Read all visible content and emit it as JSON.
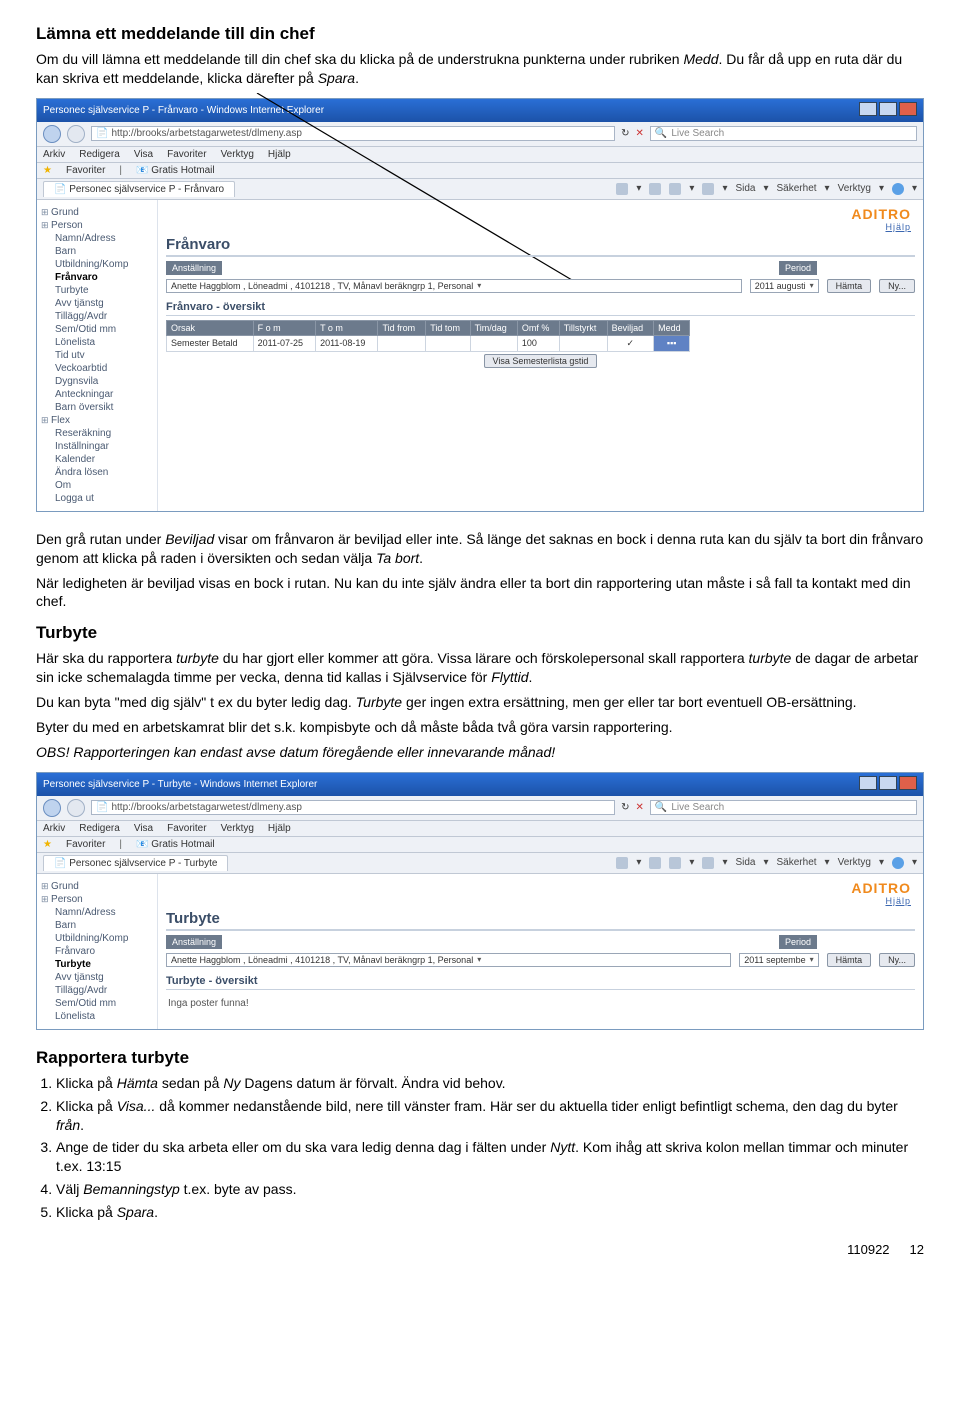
{
  "section1": {
    "heading": "Lämna ett meddelande till din chef",
    "para1_a": "Om du vill lämna ett meddelande till din chef ska du klicka på de understrukna punkterna under rubriken ",
    "para1_b": "Medd",
    "para1_c": ". Du får då upp en ruta där du kan skriva ett meddelande, klicka därefter på ",
    "para1_d": "Spara",
    "para1_e": "."
  },
  "shot1": {
    "title": "Personec självservice P - Frånvaro - Windows Internet Explorer",
    "url": "http://brooks/arbetstagarwetest/dlmeny.asp",
    "search_placeholder": "Live Search",
    "menus": [
      "Arkiv",
      "Redigera",
      "Visa",
      "Favoriter",
      "Verktyg",
      "Hjälp"
    ],
    "fav_label": "Favoriter",
    "fav_item": "Gratis Hotmail",
    "tab": "Personec självservice P - Frånvaro",
    "tools": [
      "Sida",
      "Säkerhet",
      "Verktyg"
    ],
    "brand": "ADITRO",
    "help": "Hjälp",
    "sidebar": {
      "root": "Grund",
      "person": "Person",
      "items": [
        "Namn/Adress",
        "Barn",
        "Utbildning/Komp",
        "Frånvaro",
        "Turbyte",
        "Avv tjänstg",
        "Tillägg/Avdr",
        "Sem/Otid mm",
        "Lönelista",
        "Tid utv",
        "Veckoarbtid",
        "Dygnsvila",
        "Anteckningar",
        "Barn översikt"
      ],
      "flex": "Flex",
      "flex_items": [
        "Reseräkning",
        "Inställningar",
        "Kalender",
        "Ändra lösen",
        "Om",
        "Logga ut"
      ],
      "selected": "Frånvaro"
    },
    "panel_h1": "Frånvaro",
    "label_anst": "Anställning",
    "label_period": "Period",
    "anst_value": "Anette Haggblom , Löneadmi , 4101218 , TV, Månavl beräkngrp 1, Personal",
    "period_value": "2011 augusti",
    "btn_hamta": "Hämta",
    "btn_ny": "Ny...",
    "panel_h2": "Frånvaro - översikt",
    "cols": [
      "Orsak",
      "F o m",
      "T o m",
      "Tid from",
      "Tid tom",
      "Tim/dag",
      "Omf %",
      "Tillstyrkt",
      "Beviljad",
      "Medd"
    ],
    "row": {
      "orsak": "Semester Betald",
      "fom": "2011-07-25",
      "tom": "2011-08-19",
      "omf": "100",
      "bev": "✓",
      "medd": "▪▪▪"
    },
    "bock_label": "Visa Semesterlista  gstid"
  },
  "mid": {
    "p1_a": "Den grå rutan under ",
    "p1_b": "Beviljad",
    "p1_c": " visar om frånvaron är beviljad eller inte. Så länge det saknas en bock i denna ruta kan du själv ta bort din frånvaro genom att klicka på raden i översikten och sedan välja ",
    "p1_d": "Ta bort",
    "p1_e": ".",
    "p2": "När ledigheten är beviljad visas en bock i rutan. Nu kan du inte själv ändra eller ta bort din rapportering utan måste i så fall ta kontakt med din chef.",
    "h2": "Turbyte",
    "p3_a": "Här ska du rapportera ",
    "p3_b": "turbyte",
    "p3_c": " du har gjort eller kommer att göra. Vissa lärare och förskolepersonal skall rapportera ",
    "p3_d": "turbyte",
    "p3_e": " de dagar de arbetar sin icke schemalagda timme per vecka, denna tid kallas i Självservice för ",
    "p3_f": "Flyttid",
    "p3_g": ".",
    "p4_a": "Du kan byta \"med dig själv\" t ex du byter ledig dag. ",
    "p4_b": "Turbyte",
    "p4_c": " ger ingen extra ersättning, men ger eller tar bort eventuell OB-ersättning.",
    "p5": "Byter du med en arbetskamrat blir det s.k. kompisbyte och då måste båda två göra varsin rapportering.",
    "p6_a": "OBS!",
    "p6_b": " Rapporteringen kan endast avse datum föregående eller innevarande månad!"
  },
  "shot2": {
    "title": "Personec självservice P - Turbyte - Windows Internet Explorer",
    "url": "http://brooks/arbetstagarwetest/dlmeny.asp",
    "search_placeholder": "Live Search",
    "menus": [
      "Arkiv",
      "Redigera",
      "Visa",
      "Favoriter",
      "Verktyg",
      "Hjälp"
    ],
    "fav_label": "Favoriter",
    "fav_item": "Gratis Hotmail",
    "tab": "Personec självservice P - Turbyte",
    "tools": [
      "Sida",
      "Säkerhet",
      "Verktyg"
    ],
    "brand": "ADITRO",
    "help": "Hjälp",
    "sidebar": {
      "root": "Grund",
      "person": "Person",
      "items": [
        "Namn/Adress",
        "Barn",
        "Utbildning/Komp",
        "Frånvaro",
        "Turbyte",
        "Avv tjänstg",
        "Tillägg/Avdr",
        "Sem/Otid mm",
        "Lönelista"
      ],
      "selected": "Turbyte"
    },
    "panel_h1": "Turbyte",
    "label_anst": "Anställning",
    "label_period": "Period",
    "anst_value": "Anette Haggblom , Löneadmi , 4101218 , TV, Månavl beräkngrp 1, Personal",
    "period_value": "2011 septembe",
    "btn_hamta": "Hämta",
    "btn_ny": "Ny...",
    "panel_h2": "Turbyte - översikt",
    "empty": "Inga poster funna!"
  },
  "section3": {
    "heading": "Rapportera turbyte",
    "s1_a": "Klicka på ",
    "s1_b": "Hämta",
    "s1_c": " sedan på ",
    "s1_d": "Ny",
    "s1_e": " Dagens datum är förvalt. Ändra vid behov.",
    "s2_a": "Klicka på ",
    "s2_b": "Visa...",
    "s2_c": " då kommer nedanstående bild, nere till vänster fram. Här ser du aktuella tider enligt befintligt schema, den dag du byter ",
    "s2_d": "från",
    "s2_e": ".",
    "s3_a": "Ange de tider du ska arbeta eller om du ska vara ledig denna dag i fälten under ",
    "s3_b": "Nytt",
    "s3_c": ". Kom ihåg att skriva kolon mellan timmar och minuter t.ex. 13:15",
    "s4_a": "Välj ",
    "s4_b": "Bemanningstyp",
    "s4_c": " t.ex. byte av pass.",
    "s5_a": "Klicka på ",
    "s5_b": "Spara",
    "s5_c": "."
  },
  "footer": {
    "date": "110922",
    "page": "12"
  }
}
